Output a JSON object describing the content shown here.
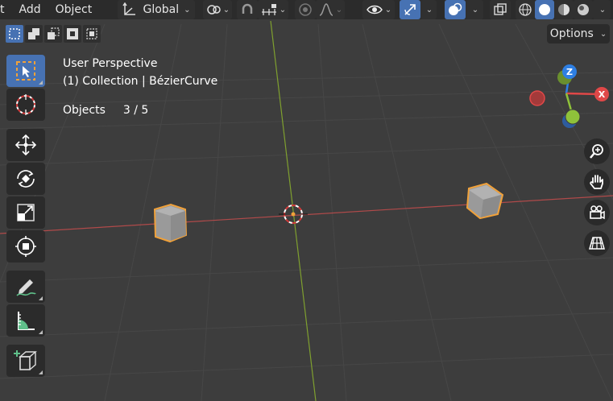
{
  "menu": {
    "view_fragment": "t",
    "add": "Add",
    "object": "Object"
  },
  "header": {
    "orientation": "Global",
    "options_label": "Options"
  },
  "overlay": {
    "perspective": "User Perspective",
    "collection": "(1) Collection | BézierCurve",
    "objects_label": "Objects",
    "objects_count": "3 / 5"
  },
  "gizmo": {
    "z": "Z",
    "x": "X"
  },
  "colors": {
    "accent": "#4772b3",
    "x_axis": "#e04848",
    "y_axis": "#8fc23a",
    "z_axis": "#2e7fe3",
    "selection": "#f0a13a"
  },
  "icons": [
    "select-box-icon",
    "cursor-icon",
    "move-icon",
    "rotate-icon",
    "scale-icon",
    "transform-icon",
    "annotate-icon",
    "measure-icon",
    "add-cube-icon",
    "zoom-icon",
    "hand-icon",
    "camera-icon",
    "grid-icon"
  ]
}
